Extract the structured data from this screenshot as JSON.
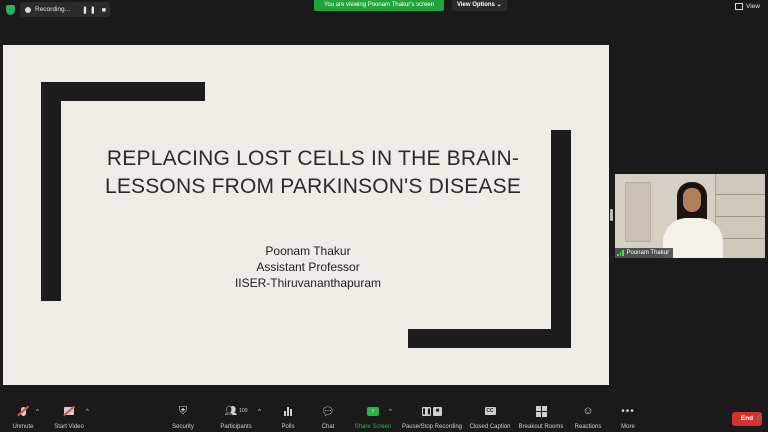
{
  "top_bar": {
    "recording_label": "Recording...",
    "recording_controls": "❚❚ ■",
    "share_banner": "You are viewing Poonam Thakur's screen",
    "view_options": "View Options ⌄",
    "view_label": "View"
  },
  "slide": {
    "title_line1": "REPLACING LOST CELLS IN THE BRAIN-",
    "title_line2": "LESSONS FROM PARKINSON'S DISEASE",
    "author_name": "Poonam Thakur",
    "author_role": "Assistant Professor",
    "author_affiliation": "IISER-Thiruvananthapuram"
  },
  "video": {
    "participant_name": "Poonam Thakur"
  },
  "toolbar": {
    "unmute": "Unmute",
    "start_video": "Start Video",
    "security": "Security",
    "participants": "Participants",
    "participant_count": "100",
    "polls": "Polls",
    "chat": "Chat",
    "share_screen": "Share Screen",
    "pause_stop_recording": "Pause/Stop Recording",
    "closed_caption": "Closed Caption",
    "breakout_rooms": "Breakout Rooms",
    "reactions": "Reactions",
    "more": "More",
    "end": "End",
    "cc_glyph": "CC",
    "caret": "^"
  },
  "colors": {
    "share_green": "#23a33b",
    "end_red": "#d3332e",
    "slide_bg": "#efebe6"
  }
}
